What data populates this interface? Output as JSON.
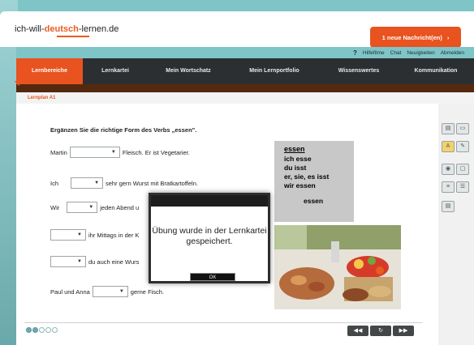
{
  "site": {
    "logo_pre": "ich-will-",
    "logo_hl": "deutsch",
    "logo_post": "-lernen.de"
  },
  "message_button": {
    "label": "1 neue Nachricht(en)",
    "arrow": "›"
  },
  "toplinks": [
    {
      "icon": "?",
      "label": "Hilfefilme"
    },
    {
      "label": "Chat"
    },
    {
      "label": "Neuigkeiten"
    },
    {
      "label": "Abmelden"
    }
  ],
  "nav": [
    {
      "label": "Lernbereiche",
      "active": true
    },
    {
      "label": "Lernkartei"
    },
    {
      "label": "Mein Wortschatz"
    },
    {
      "label": "Mein Lernportfolio"
    },
    {
      "label": "Wissenswertes"
    },
    {
      "label": "Kommunikation"
    }
  ],
  "breadcrumb": "Lernplan A1",
  "exercise": {
    "instruction": "Ergänzen Sie die richtige Form des Verbs „essen\".",
    "rows": [
      {
        "before": "Martin",
        "after": "Fleisch. Er ist Vegetarier."
      },
      {
        "before": "Ich",
        "after": "sehr gern Wurst mit Bratkartoffeln."
      },
      {
        "before": "Wir",
        "after": "jeden Abend u"
      },
      {
        "before": "",
        "after": "ihr Mittags in der K"
      },
      {
        "before": "",
        "after": "du auch eine Wurs"
      },
      {
        "before": "Paul und Anna",
        "after": "gerne Fisch."
      }
    ],
    "select_arrow": "▼"
  },
  "verb_box": {
    "title": "essen",
    "forms": [
      "ich esse",
      "du isst",
      "er, sie, es isst",
      "wir essen",
      "",
      "essen"
    ]
  },
  "dialog": {
    "message": "Übung wurde in der Lernkartei gespeichert.",
    "ok_label": "OK"
  },
  "pager": {
    "prev": "◀◀",
    "reload": "↻",
    "next": "▶▶"
  },
  "progress_dots": {
    "total": 5,
    "filled": 2
  },
  "colors": {
    "accent": "#e8531f",
    "nav_bg": "#2b2f31",
    "teal": "#7fc4c7"
  }
}
